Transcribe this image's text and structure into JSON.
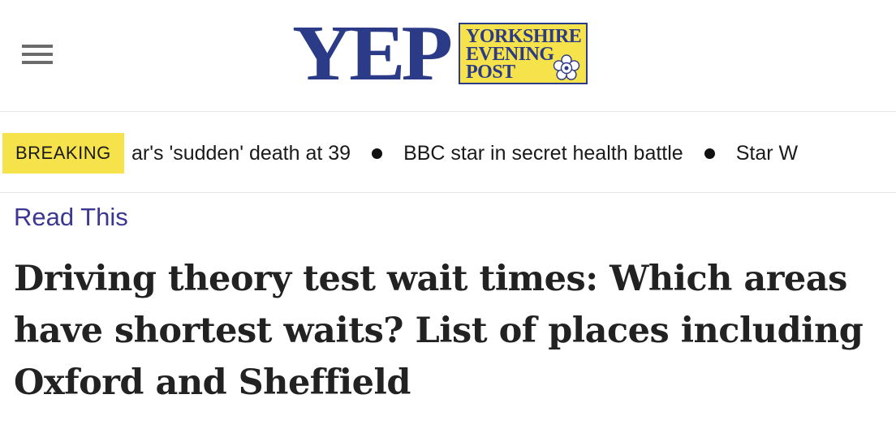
{
  "header": {
    "menu_icon": "hamburger-menu-icon",
    "logo": {
      "abbrev": "YEP",
      "line1": "YORKSHIRE",
      "line2": "EVENING",
      "line3": "POST",
      "emblem_icon": "yorkshire-rose-icon"
    }
  },
  "breaking": {
    "label": "BREAKING",
    "items": [
      "ar's 'sudden' death at 39",
      "BBC star in secret health battle",
      "Star W"
    ]
  },
  "article": {
    "kicker": "Read This",
    "headline": "Driving theory test wait times: Which areas have shortest waits? List of places including Oxford and Sheffield"
  },
  "colors": {
    "brand_blue": "#2c3b87",
    "brand_yellow": "#f6e24a",
    "kicker_purple": "#3b3792",
    "headline_text": "#222222"
  }
}
